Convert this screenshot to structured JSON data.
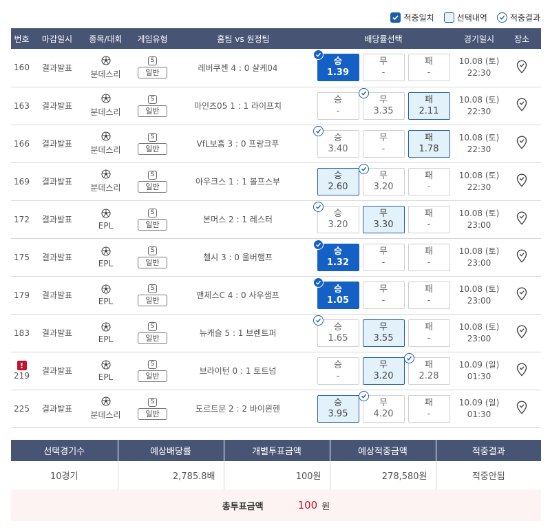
{
  "legend": {
    "hit_match": "적중일치",
    "selected": "선택내역",
    "result": "적중결과"
  },
  "headers": [
    "번호",
    "마감일시",
    "종목/대회",
    "게임유형",
    "홈팀 vs 원정팀",
    "배당률선택",
    "경기일시",
    "장소"
  ],
  "game_type_icon": "S",
  "rows": [
    {
      "no": "160",
      "alert": "",
      "deadline": "결과발표",
      "league": "분데스리",
      "type": "일반",
      "match": "레버쿠젠 4 : 0 샬케04",
      "odds": [
        {
          "label": "승",
          "value": "1.39",
          "state": "hit",
          "check": true
        },
        {
          "label": "무",
          "value": "-",
          "state": "",
          "check": false
        },
        {
          "label": "패",
          "value": "-",
          "state": "",
          "check": false
        }
      ],
      "date": "10.08 (토)",
      "time": "22:30"
    },
    {
      "no": "163",
      "alert": "",
      "deadline": "결과발표",
      "league": "분데스리",
      "type": "일반",
      "match": "마인츠05 1 : 1 라이프치",
      "odds": [
        {
          "label": "승",
          "value": "-",
          "state": "",
          "check": false
        },
        {
          "label": "무",
          "value": "3.35",
          "state": "",
          "check": true
        },
        {
          "label": "패",
          "value": "2.11",
          "state": "sel",
          "check": false
        }
      ],
      "date": "10.08 (토)",
      "time": "22:30"
    },
    {
      "no": "166",
      "alert": "",
      "deadline": "결과발표",
      "league": "분데스리",
      "type": "일반",
      "match": "VfL보훔 3 : 0 프랑크푸",
      "odds": [
        {
          "label": "승",
          "value": "3.40",
          "state": "",
          "check": true
        },
        {
          "label": "무",
          "value": "-",
          "state": "",
          "check": false
        },
        {
          "label": "패",
          "value": "1.78",
          "state": "sel",
          "check": false
        }
      ],
      "date": "10.08 (토)",
      "time": "22:30"
    },
    {
      "no": "169",
      "alert": "",
      "deadline": "결과발표",
      "league": "분데스리",
      "type": "일반",
      "match": "아우크스 1 : 1 볼프스부",
      "odds": [
        {
          "label": "승",
          "value": "2.60",
          "state": "sel",
          "check": false
        },
        {
          "label": "무",
          "value": "3.20",
          "state": "",
          "check": true
        },
        {
          "label": "패",
          "value": "-",
          "state": "",
          "check": false
        }
      ],
      "date": "10.08 (토)",
      "time": "22:30"
    },
    {
      "no": "172",
      "alert": "",
      "deadline": "결과발표",
      "league": "EPL",
      "type": "일반",
      "match": "본머스 2 : 1 레스터",
      "odds": [
        {
          "label": "승",
          "value": "3.20",
          "state": "",
          "check": true
        },
        {
          "label": "무",
          "value": "3.30",
          "state": "sel",
          "check": false
        },
        {
          "label": "패",
          "value": "-",
          "state": "",
          "check": false
        }
      ],
      "date": "10.08 (토)",
      "time": "23:00"
    },
    {
      "no": "175",
      "alert": "",
      "deadline": "결과발표",
      "league": "EPL",
      "type": "일반",
      "match": "첼시 3 : 0 울버햄프",
      "odds": [
        {
          "label": "승",
          "value": "1.32",
          "state": "hit",
          "check": true
        },
        {
          "label": "무",
          "value": "-",
          "state": "",
          "check": false
        },
        {
          "label": "패",
          "value": "-",
          "state": "",
          "check": false
        }
      ],
      "date": "10.08 (토)",
      "time": "23:00"
    },
    {
      "no": "179",
      "alert": "",
      "deadline": "결과발표",
      "league": "EPL",
      "type": "일반",
      "match": "맨체스C 4 : 0 사우샘프",
      "odds": [
        {
          "label": "승",
          "value": "1.05",
          "state": "hit",
          "check": true
        },
        {
          "label": "무",
          "value": "-",
          "state": "",
          "check": false
        },
        {
          "label": "패",
          "value": "-",
          "state": "",
          "check": false
        }
      ],
      "date": "10.08 (토)",
      "time": "23:00"
    },
    {
      "no": "183",
      "alert": "",
      "deadline": "결과발표",
      "league": "EPL",
      "type": "일반",
      "match": "뉴캐슬 5 : 1 브렌트퍼",
      "odds": [
        {
          "label": "승",
          "value": "1.65",
          "state": "",
          "check": true
        },
        {
          "label": "무",
          "value": "3.55",
          "state": "sel",
          "check": false
        },
        {
          "label": "패",
          "value": "-",
          "state": "",
          "check": false
        }
      ],
      "date": "10.08 (토)",
      "time": "23:00"
    },
    {
      "no": "219",
      "alert": "!",
      "deadline": "결과발표",
      "league": "EPL",
      "type": "일반",
      "match": "브라이턴 0 : 1 토트넘",
      "odds": [
        {
          "label": "승",
          "value": "-",
          "state": "",
          "check": false
        },
        {
          "label": "무",
          "value": "3.20",
          "state": "sel",
          "check": false
        },
        {
          "label": "패",
          "value": "2.28",
          "state": "",
          "check": true
        }
      ],
      "date": "10.09 (일)",
      "time": "01:30"
    },
    {
      "no": "225",
      "alert": "",
      "deadline": "결과발표",
      "league": "분데스리",
      "type": "일반",
      "match": "도르트문 2 : 2 바이뮌헨",
      "odds": [
        {
          "label": "승",
          "value": "3.95",
          "state": "sel",
          "check": false
        },
        {
          "label": "무",
          "value": "4.20",
          "state": "",
          "check": true
        },
        {
          "label": "패",
          "value": "-",
          "state": "",
          "check": false
        }
      ],
      "date": "10.09 (일)",
      "time": "01:30"
    }
  ],
  "summary": {
    "headers": [
      "선택경기수",
      "예상배당률",
      "개별투표금액",
      "예상적중금액",
      "적중결과"
    ],
    "values": [
      "10경기",
      "2,785.8배",
      "100원",
      "278,580원",
      "적중안됨"
    ]
  },
  "total": {
    "label": "총투표금액",
    "amount": "100",
    "unit": "원"
  },
  "colors": {
    "header_bg": "#485474",
    "hit": "#1560c4",
    "selected_bg": "#e3f1fb",
    "accent": "#1e5ea8",
    "alert": "#c4132e",
    "total_bg": "#fdf3f3"
  }
}
